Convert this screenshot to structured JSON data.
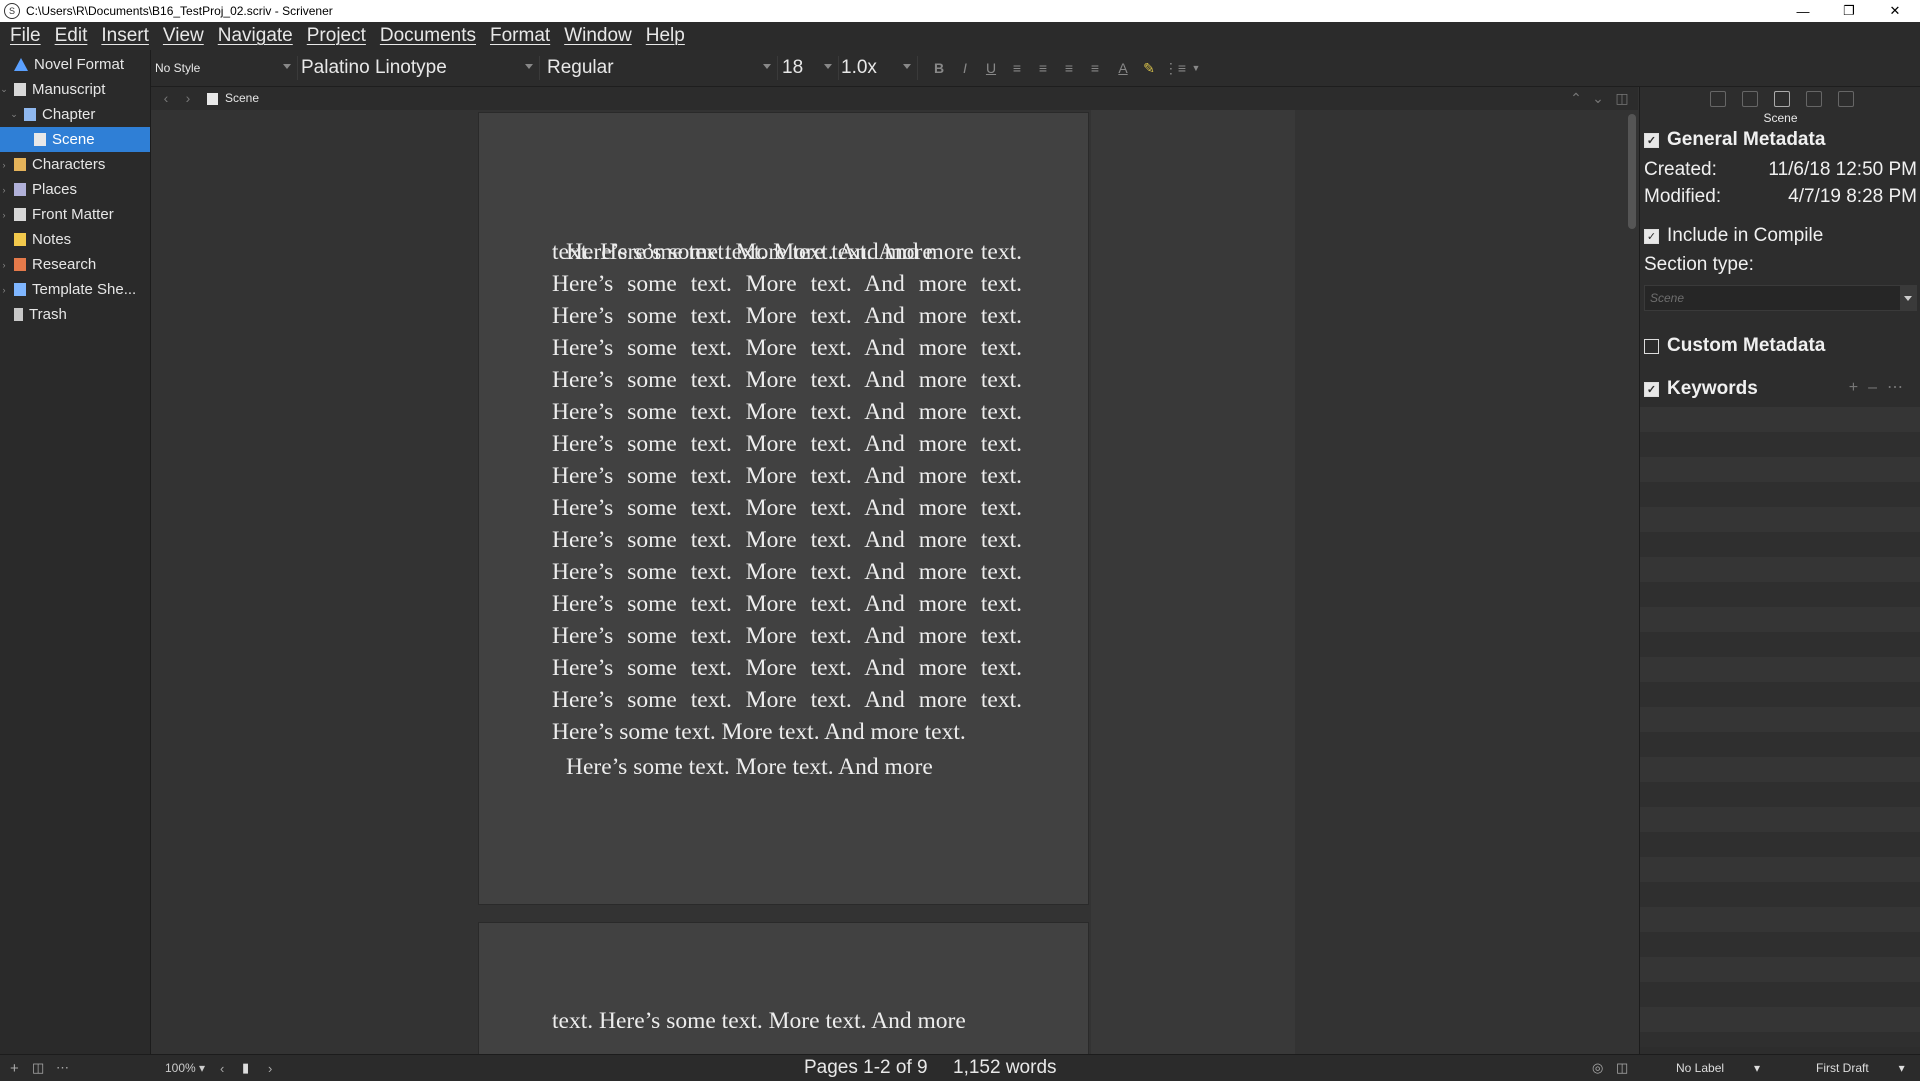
{
  "window": {
    "title": "C:\\Users\\R\\Documents\\B16_TestProj_02.scriv - Scrivener",
    "app_icon": "scrivener-icon"
  },
  "menu": [
    "File",
    "Edit",
    "Insert",
    "View",
    "Navigate",
    "Project",
    "Documents",
    "Format",
    "Window",
    "Help"
  ],
  "binder": {
    "items": [
      {
        "label": "Novel Format",
        "icon": "novel-format-icon",
        "color": "#5aa0ff"
      },
      {
        "label": "Manuscript",
        "icon": "manuscript-icon",
        "color": "#d8d8d8"
      },
      {
        "label": "Chapter",
        "icon": "folder-icon",
        "color": "#8fb8ef"
      },
      {
        "label": "Scene",
        "icon": "document-icon",
        "color": "#e8e8e8"
      },
      {
        "label": "Characters",
        "icon": "characters-folder-icon",
        "color": "#e5b35a"
      },
      {
        "label": "Places",
        "icon": "places-folder-icon",
        "color": "#b0b0d8"
      },
      {
        "label": "Front Matter",
        "icon": "front-matter-icon",
        "color": "#d8d8d8"
      },
      {
        "label": "Notes",
        "icon": "notes-folder-icon",
        "color": "#f2c94c"
      },
      {
        "label": "Research",
        "icon": "research-folder-icon",
        "color": "#e57a4a"
      },
      {
        "label": "Template She...",
        "icon": "template-sheets-icon",
        "color": "#7fb6ff"
      },
      {
        "label": "Trash",
        "icon": "trash-icon",
        "color": "#c8c8c8"
      }
    ],
    "selected_color": "#2f7fd6"
  },
  "formatbar": {
    "style": "No Style",
    "font": "Palatino Linotype",
    "weight": "Regular",
    "size": "18",
    "spacing": "1.0x"
  },
  "header": {
    "doc_title": "Scene"
  },
  "editor": {
    "para1": "text. Here’s some text. More text. And more text. Here’s some text. More text. And more text. Here’s some text. More text. And more text. Here’s some text. More text. And more text. Here’s some text. More text. And more text. Here’s some text. More text. And more text. Here’s some text. More text. And more text. Here’s some text. More text. And more text. Here’s some text. More text. And more text. Here’s some text. More text. And more text. Here’s some text. More text. And more text. Here’s some text. More text. And more text. Here’s some text. More text. And more text. Here’s some text. More text. And more text. Here’s some text. More text. And more text. Here’s some text. More text. And more text.",
    "para1_first": "Here’s some text. More text. And more",
    "para2": "Here’s some text. More text. And more",
    "page2_line": "text. Here’s some text. More text. And more"
  },
  "inspector": {
    "title": "Scene",
    "general_metadata": "General Metadata",
    "created_label": "Created:",
    "created_value": "11/6/18 12:50 PM",
    "modified_label": "Modified:",
    "modified_value": "4/7/19 8:28 PM",
    "include_compile": "Include in Compile",
    "section_type_label": "Section type:",
    "section_type_value": "Scene",
    "custom_metadata": "Custom Metadata",
    "keywords": "Keywords"
  },
  "footer": {
    "zoom": "100%",
    "pages": "Pages 1-2 of 9",
    "words": "1,152 words",
    "label": "No Label",
    "status": "First Draft"
  }
}
